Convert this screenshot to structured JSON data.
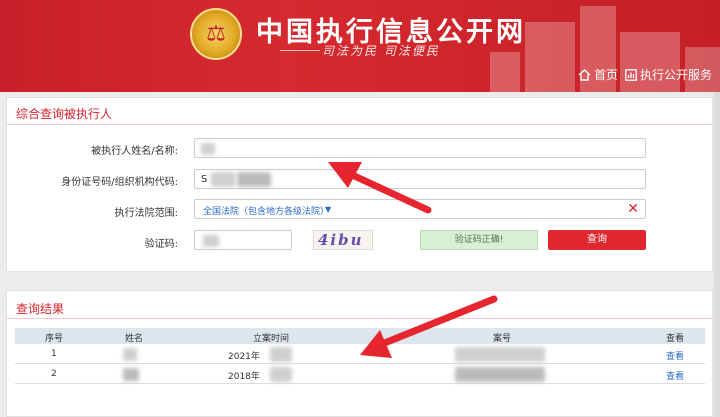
{
  "header": {
    "emblem_glyph": "⚖",
    "site_title": "中国执行信息公开网",
    "slogan": "司法为民  司法便民",
    "nav": [
      {
        "label": "首页",
        "icon": "home-icon"
      },
      {
        "label": "执行公开服务",
        "icon": "chart-icon"
      }
    ]
  },
  "query": {
    "section_title": "综合查询被执行人",
    "name_label": "被执行人姓名/名称:",
    "name_value": "",
    "id_label": "身份证号码/组织机构代码:",
    "id_value": "S",
    "court_label": "执行法院范围:",
    "court_value": "全国法院（包含地方各级法院）",
    "captcha_label": "验证码:",
    "captcha_value": "",
    "captcha_image_text": "4ibu",
    "captcha_ok_label": "验证码正确!",
    "search_button": "查询"
  },
  "results": {
    "section_title": "查询结果",
    "columns": [
      "序号",
      "姓名",
      "立案时间",
      "案号",
      "查看"
    ],
    "rows": [
      {
        "index": "1",
        "name": "",
        "date": "2021年",
        "case_no": "",
        "view": "查看"
      },
      {
        "index": "2",
        "name": "",
        "date": "2018年",
        "case_no": "",
        "view": "查看"
      }
    ]
  },
  "colors": {
    "brand_red": "#d52a2f",
    "link_blue": "#2a6bc8",
    "success_green": "#d9efd6"
  }
}
